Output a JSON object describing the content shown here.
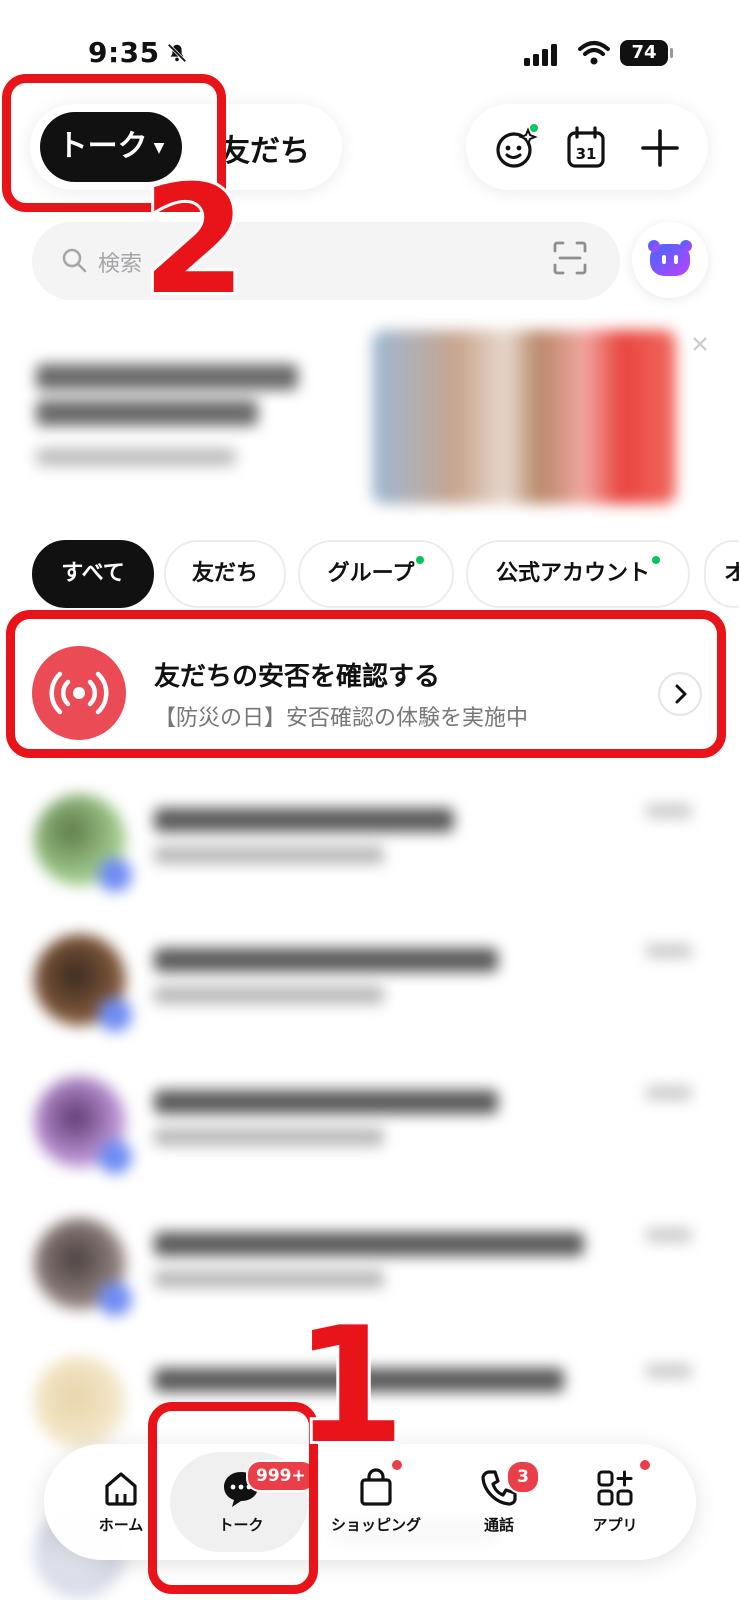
{
  "status_bar": {
    "time": "9:35",
    "battery": "74"
  },
  "header": {
    "talk_tab": "トーク",
    "friends_tab": "友だち"
  },
  "search": {
    "placeholder": "検索"
  },
  "filters": [
    {
      "label": "すべて",
      "active": true,
      "dot": false
    },
    {
      "label": "友だち",
      "active": false,
      "dot": false
    },
    {
      "label": "グループ",
      "active": false,
      "dot": true
    },
    {
      "label": "公式アカウント",
      "active": false,
      "dot": true
    },
    {
      "label": "オ",
      "active": false,
      "dot": false
    }
  ],
  "safety_check": {
    "title": "友だちの安否を確認する",
    "subtitle": "【防災の日】安否確認の体験を実施中"
  },
  "annotations": {
    "step1": "1",
    "step2": "2"
  },
  "bottom_nav": {
    "home": "ホーム",
    "talk": "トーク",
    "talk_badge": "999+",
    "shopping": "ショッピング",
    "calls": "通話",
    "calls_badge": "3",
    "apps": "アプリ"
  },
  "colors": {
    "accent_red": "#e8141a",
    "badge_red": "#ea3f49",
    "line_green": "#06c755",
    "alert_red": "#ea4b55"
  }
}
